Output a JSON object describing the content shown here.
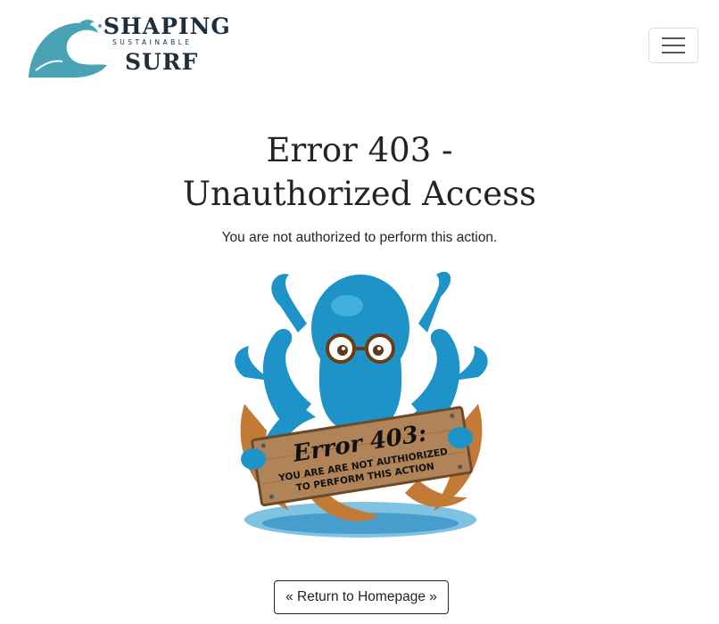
{
  "navbar": {
    "logo": {
      "line1": "SHAPING",
      "line2": "SUSTAINABLE",
      "line3": "SURF",
      "icon": "wave-icon",
      "colors": {
        "wave": "#4aa3b4",
        "text": "#1f2e3d"
      }
    },
    "menu_icon": "hamburger-menu-icon"
  },
  "error": {
    "title_line1": "Error 403 -",
    "title_line2": "Unauthorized Access",
    "message": "You are not authorized to perform this action."
  },
  "illustration": {
    "sign_title": "Error 403:",
    "sign_line1": "YOU ARE ARE NOT AUTHIORIZED",
    "sign_line2": "TO PERFORM THIS ACTION",
    "colors": {
      "octopus": "#1d93c8",
      "tentacle_underside": "#c27a36",
      "wood": "#b08458",
      "water": "#5fb3d9"
    }
  },
  "actions": {
    "return_home": "« Return to Homepage »"
  }
}
